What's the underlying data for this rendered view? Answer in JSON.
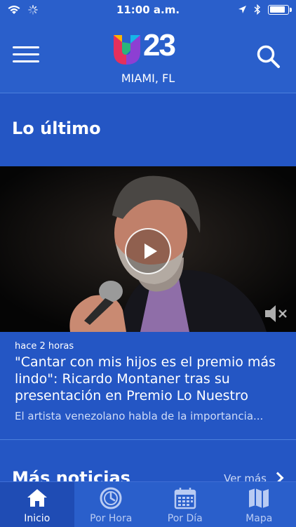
{
  "status_bar": {
    "time": "11:00 a.m.",
    "battery_level": 0.9
  },
  "header": {
    "logo_text": "23",
    "city": "MIAMI, FL"
  },
  "section": {
    "title": "Lo último"
  },
  "featured": {
    "time_ago": "hace 2 horas",
    "title": "\"Cantar con mis hijos es el premio más lindo\": Ricardo Montaner tras su presentación en Premio Lo Nuestro",
    "description": "El artista venezolano habla de la importancia..."
  },
  "more_news": {
    "title": "Más noticias",
    "link_label": "Ver más"
  },
  "tabs": [
    {
      "label": "Inicio",
      "icon": "home-icon",
      "active": true
    },
    {
      "label": "Por Hora",
      "icon": "clock-icon",
      "active": false
    },
    {
      "label": "Por Día",
      "icon": "calendar-icon",
      "active": false
    },
    {
      "label": "Mapa",
      "icon": "map-icon",
      "active": false
    }
  ],
  "colors": {
    "brand_blue": "#2456c4",
    "header_blue": "#2a5fcb",
    "active_tab": "#1f4cb4"
  }
}
